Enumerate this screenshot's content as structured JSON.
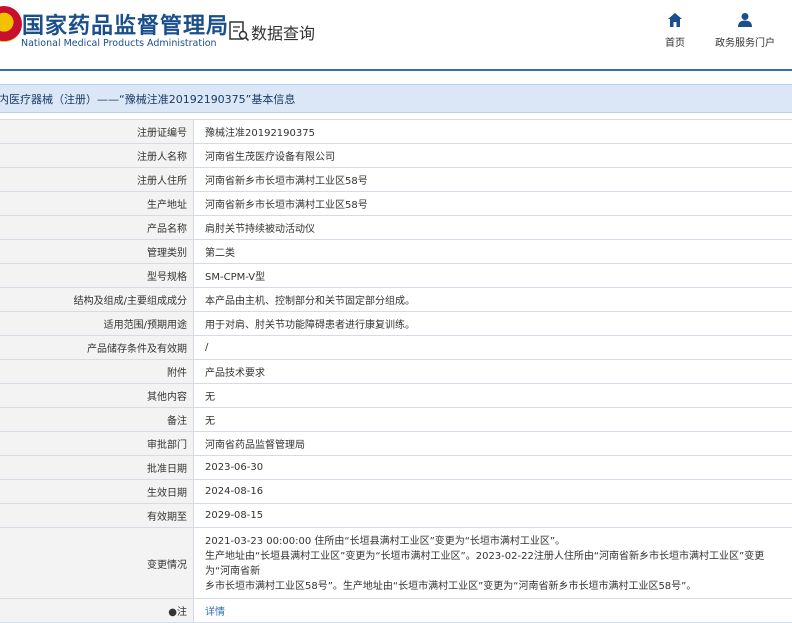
{
  "header": {
    "title_cn": "国家药品监督管理局",
    "title_en": "National Medical Products Administration",
    "query_label": "数据查询",
    "nav": [
      {
        "label": "首页",
        "icon": "home-icon"
      },
      {
        "label": "政务服务门户",
        "icon": "user-icon"
      }
    ]
  },
  "page_title": "内医疗器械（注册）——“豫械注准20192190375”基本信息",
  "rows": [
    {
      "label": "注册证编号",
      "value": "豫械注准20192190375"
    },
    {
      "label": "注册人名称",
      "value": "河南省生茂医疗设备有限公司"
    },
    {
      "label": "注册人住所",
      "value": "河南省新乡市长垣市满村工业区58号"
    },
    {
      "label": "生产地址",
      "value": "河南省新乡市长垣市满村工业区58号"
    },
    {
      "label": "产品名称",
      "value": "肩肘关节持续被动活动仪"
    },
    {
      "label": "管理类别",
      "value": "第二类"
    },
    {
      "label": "型号规格",
      "value": "SM-CPM-V型"
    },
    {
      "label": "结构及组成/主要组成成分",
      "value": "本产品由主机、控制部分和关节固定部分组成。"
    },
    {
      "label": "适用范围/预期用途",
      "value": "用于对肩、肘关节功能障碍患者进行康复训练。"
    },
    {
      "label": "产品储存条件及有效期",
      "value": "/"
    },
    {
      "label": "附件",
      "value": "产品技术要求"
    },
    {
      "label": "其他内容",
      "value": "无"
    },
    {
      "label": "备注",
      "value": "无"
    },
    {
      "label": "审批部门",
      "value": "河南省药品监督管理局"
    },
    {
      "label": "批准日期",
      "value": "2023-06-30"
    },
    {
      "label": "生效日期",
      "value": "2024-08-16"
    },
    {
      "label": "有效期至",
      "value": "2029-08-15"
    }
  ],
  "change": {
    "label": "变更情况",
    "lines": [
      "2021-03-23 00:00:00 住所由“长垣县满村工业区”变更为“长垣市满村工业区”。",
      "生产地址由“长垣县满村工业区”变更为“长垣市满村工业区”。2023-02-22注册人住所由“河南省新乡市长垣市满村工业区”变更为“河南省新",
      "乡市长垣市满村工业区58号”。生产地址由“长垣市满村工业区”变更为“河南省新乡市长垣市满村工业区58号”。"
    ]
  },
  "note": {
    "label": "●注",
    "link": "详情"
  },
  "colors": {
    "brand": "#1a4f8c",
    "accent": "#2f6fb3",
    "title_bg": "#dbe7f6",
    "label_bg": "#f3f3f3"
  }
}
